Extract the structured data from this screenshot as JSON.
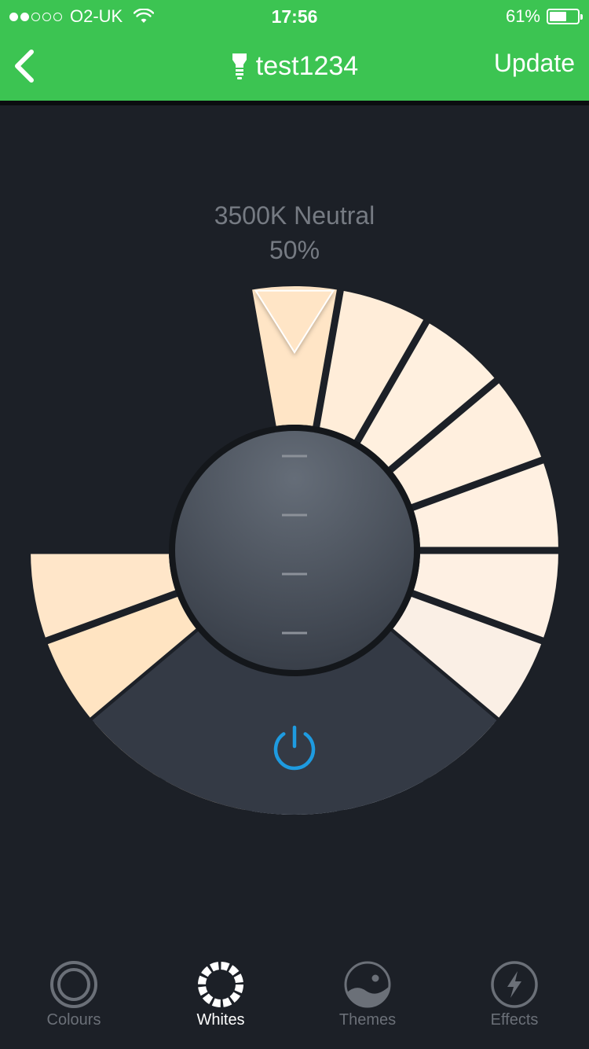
{
  "status_bar": {
    "carrier": "O2-UK",
    "signal_bars_filled": 2,
    "signal_bars_total": 5,
    "time": "17:56",
    "battery": "61%",
    "battery_level": 0.61
  },
  "nav": {
    "title": "test1234",
    "update_label": "Update",
    "back_icon": "chevron-left-icon",
    "device_icon": "bulb-icon"
  },
  "readout": {
    "temperature": "3500K Neutral",
    "brightness": "50%"
  },
  "wheel": {
    "segment_colors": [
      "#ffe5c6",
      "#ffedd9",
      "#fff0df",
      "#ffefde",
      "#fff0e1",
      "#fef0e3",
      "#faefe5",
      "#f4eee8",
      "#e8f0fa",
      "#e6effb",
      "#ffdfb8",
      "#ffe2ba",
      "#ffe4c2",
      "#ffe6c9"
    ],
    "selected_index": 0,
    "brightness_levels": 4,
    "power_color": "#1e9be0"
  },
  "tabs": [
    {
      "label": "Colours",
      "icon": "colours-icon",
      "active": false
    },
    {
      "label": "Whites",
      "icon": "whites-icon",
      "active": true
    },
    {
      "label": "Themes",
      "icon": "themes-icon",
      "active": false
    },
    {
      "label": "Effects",
      "icon": "effects-icon",
      "active": false
    }
  ],
  "colors": {
    "accent": "#3cc452",
    "background": "#1c2027",
    "inactive": "#6b7078"
  }
}
